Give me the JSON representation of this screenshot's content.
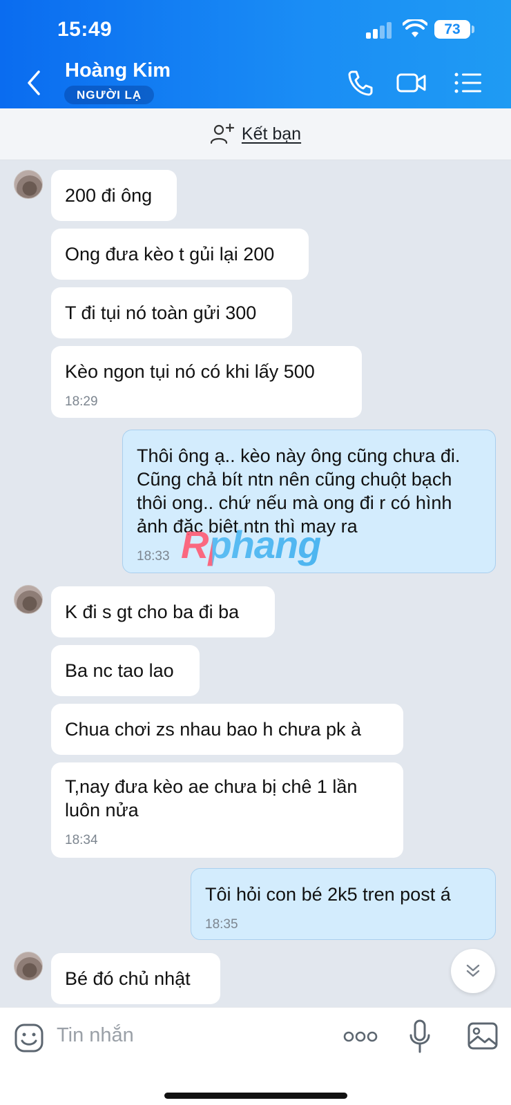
{
  "status_bar": {
    "time": "15:49",
    "battery": "73"
  },
  "header": {
    "contact_name": "Hoàng Kim",
    "badge": "NGƯỜI LẠ"
  },
  "friend_bar": {
    "label": "Kết bạn"
  },
  "messages": [
    {
      "text": "200 đi ông"
    },
    {
      "text": "Ong đưa kèo t gủi lại 200"
    },
    {
      "text": "T đi tụi nó toàn gửi 300"
    },
    {
      "text": "Kèo ngon tụi nó có khi lấy 500",
      "time": "18:29"
    },
    {
      "text": "Thôi ông ạ.. kèo này ông cũng chưa đi.  Cũng chả bít ntn nên cũng chuột bạch thôi ong.. chứ nếu mà ong đi r có hình ảnh đặc biêt ntn thì may ra",
      "time": "18:33"
    },
    {
      "text": "K đi s gt cho ba đi ba"
    },
    {
      "text": "Ba nc tao lao"
    },
    {
      "text": "Chua chơi zs nhau bao h chưa pk à"
    },
    {
      "text": "T,nay đưa kèo ae chưa bị chê 1 lần luôn nửa",
      "time": "18:34"
    },
    {
      "text": "Tôi hỏi con bé 2k5 tren post á",
      "time": "18:35"
    },
    {
      "text": "Bé đó chủ nhật"
    }
  ],
  "watermark": "Rphang",
  "input": {
    "placeholder": "Tin nhắn"
  }
}
